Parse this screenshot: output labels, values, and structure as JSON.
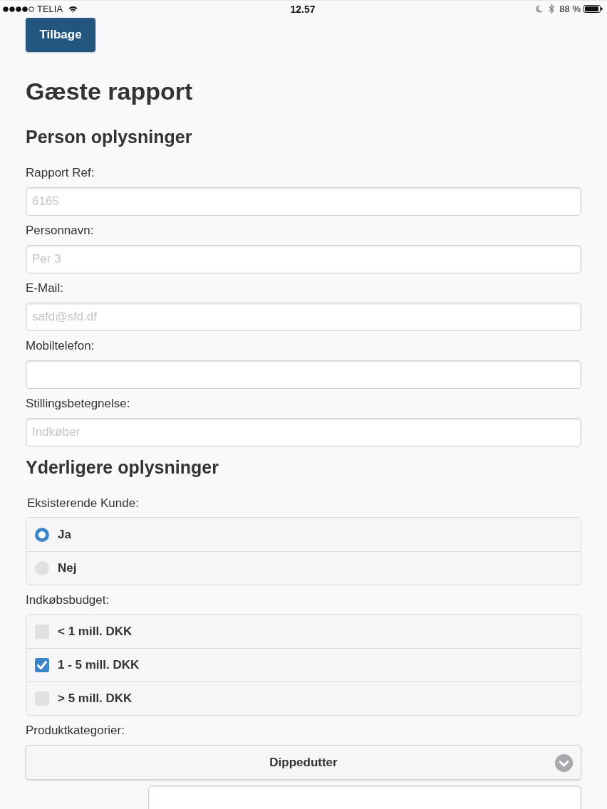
{
  "status_bar": {
    "carrier": "TELIA",
    "time": "12.57",
    "battery": "88 %"
  },
  "back_button": {
    "label": "Tilbage"
  },
  "title": "Gæste rapport",
  "sections": [
    {
      "heading": "Person oplysninger",
      "fields": [
        {
          "kind": "input",
          "label": "Rapport Ref:",
          "placeholder": "6165"
        },
        {
          "kind": "input",
          "label": "Personnavn:",
          "placeholder": "Per 3"
        },
        {
          "kind": "input",
          "label": "E-Mail:",
          "placeholder": "safd@sfd.df"
        },
        {
          "kind": "input",
          "label": "Mobiltelefon:"
        },
        {
          "kind": "input",
          "label": "Stillingsbetegnelse:",
          "placeholder": "Indkøber"
        }
      ]
    },
    {
      "heading": "Yderligere oplysninger",
      "fields": [
        {
          "kind": "radio",
          "label": "Eksisterende Kunde:",
          "options": [
            {
              "label": "Ja",
              "selected": true
            },
            {
              "label": "Nej",
              "selected": false
            }
          ]
        },
        {
          "kind": "checkbox",
          "label": "Indkøbsbudget:",
          "options": [
            {
              "label": "< 1 mill. DKK",
              "checked": false
            },
            {
              "label": "1 - 5 mill. DKK",
              "checked": true
            },
            {
              "label": "> 5 mill. DKK",
              "checked": false
            }
          ]
        },
        {
          "kind": "select",
          "label": "Produktkategorier:",
          "value": "Dippedutter"
        },
        {
          "kind": "inline-input"
        }
      ]
    }
  ]
}
